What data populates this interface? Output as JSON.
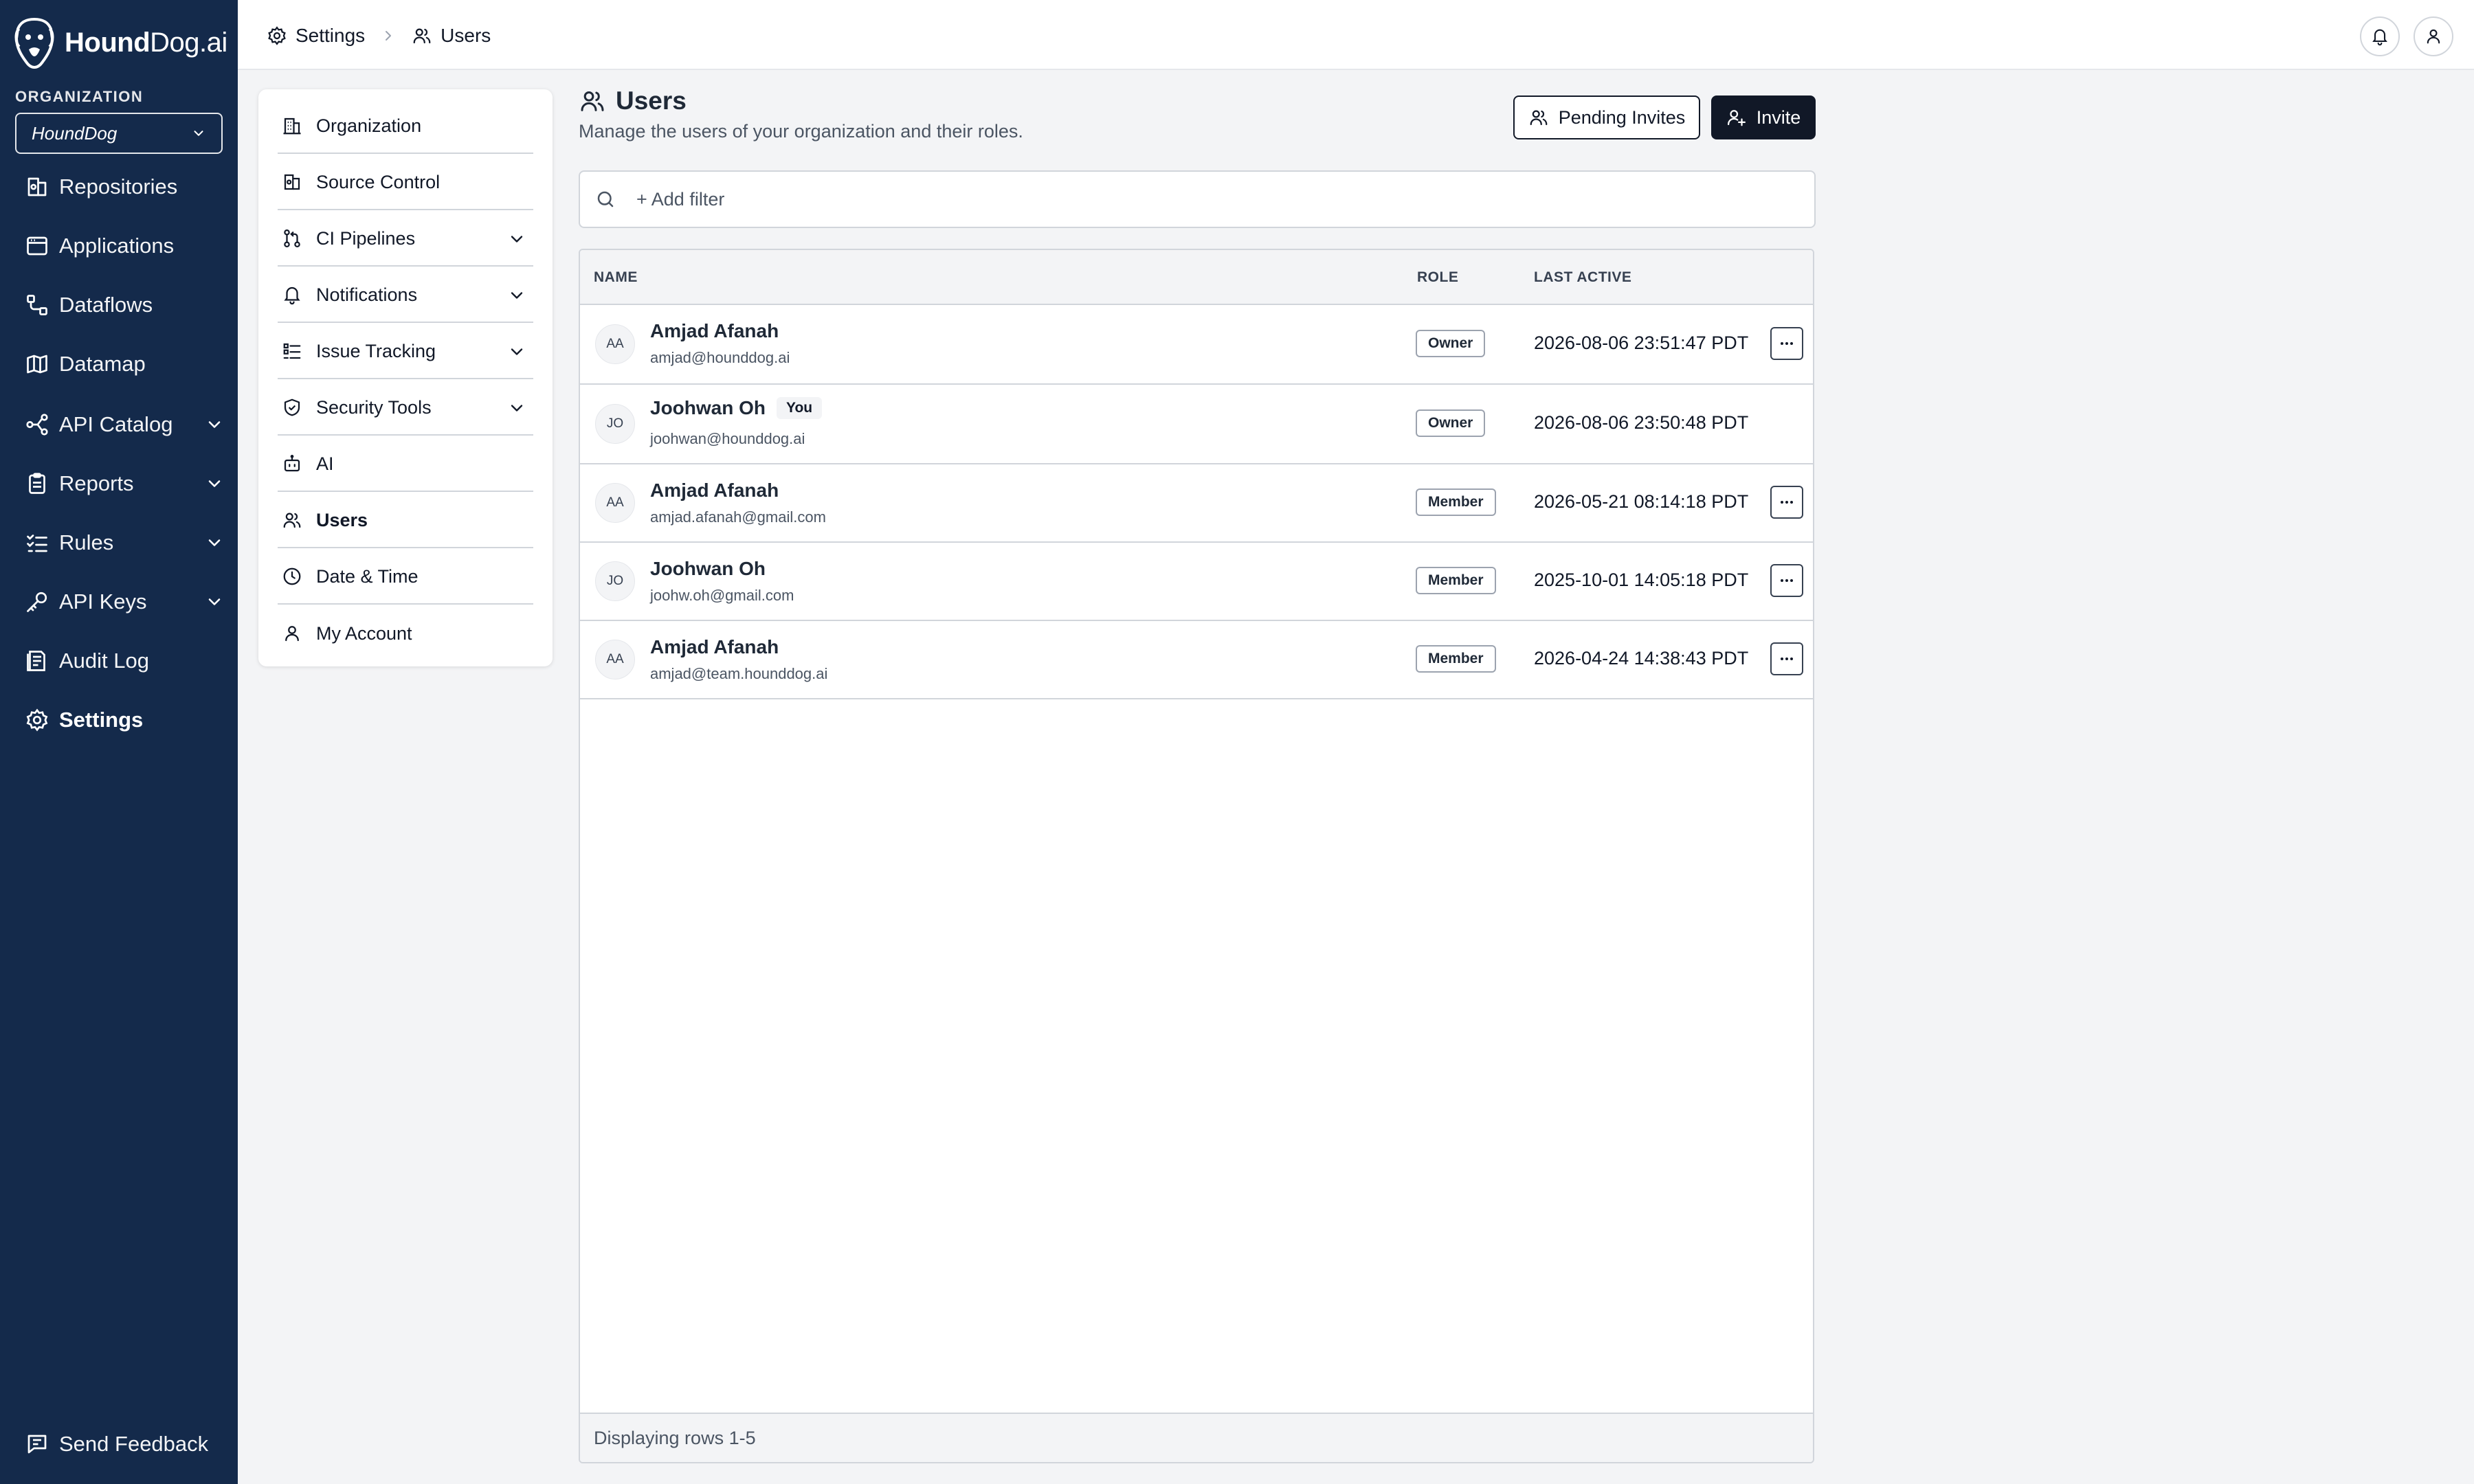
{
  "brand": {
    "name_bold": "Hound",
    "name_rest": "Dog.ai"
  },
  "organization": {
    "label": "ORGANIZATION",
    "selected": "HoundDog"
  },
  "sidebar": {
    "items": [
      {
        "label": "Repositories",
        "icon": "repository-icon"
      },
      {
        "label": "Applications",
        "icon": "application-icon"
      },
      {
        "label": "Dataflows",
        "icon": "dataflow-icon"
      },
      {
        "label": "Datamap",
        "icon": "map-icon"
      },
      {
        "label": "API Catalog",
        "icon": "api-icon",
        "expandable": true
      },
      {
        "label": "Reports",
        "icon": "report-icon",
        "expandable": true
      },
      {
        "label": "Rules",
        "icon": "rules-icon",
        "expandable": true
      },
      {
        "label": "API Keys",
        "icon": "key-icon",
        "expandable": true
      },
      {
        "label": "Audit Log",
        "icon": "audit-log-icon"
      },
      {
        "label": "Settings",
        "icon": "gear-icon",
        "active": true
      }
    ],
    "feedback_label": "Send Feedback"
  },
  "breadcrumb": {
    "root": "Settings",
    "current": "Users"
  },
  "settings_nav": {
    "items": [
      {
        "label": "Organization",
        "icon": "building-icon"
      },
      {
        "label": "Source Control",
        "icon": "source-control-icon"
      },
      {
        "label": "CI Pipelines",
        "icon": "pipeline-icon",
        "expandable": true
      },
      {
        "label": "Notifications",
        "icon": "bell-icon",
        "expandable": true
      },
      {
        "label": "Issue Tracking",
        "icon": "issue-list-icon",
        "expandable": true
      },
      {
        "label": "Security Tools",
        "icon": "shield-icon",
        "expandable": true
      },
      {
        "label": "AI",
        "icon": "bot-icon"
      },
      {
        "label": "Users",
        "icon": "users-icon",
        "active": true
      },
      {
        "label": "Date & Time",
        "icon": "clock-icon"
      },
      {
        "label": "My Account",
        "icon": "user-icon"
      }
    ]
  },
  "page": {
    "title": "Users",
    "subtitle": "Manage the users of your organization and their roles.",
    "pending_invites_label": "Pending Invites",
    "invite_label": "Invite",
    "filter_placeholder": "+ Add filter"
  },
  "table": {
    "columns": {
      "name": "NAME",
      "role": "ROLE",
      "last_active": "LAST ACTIVE"
    },
    "rows": [
      {
        "initials": "AA",
        "name": "Amjad Afanah",
        "email": "amjad@hounddog.ai",
        "role": "Owner",
        "last_active": "2026-08-06 23:51:47 PDT",
        "you": false,
        "actions": true
      },
      {
        "initials": "JO",
        "name": "Joohwan Oh",
        "email": "joohwan@hounddog.ai",
        "role": "Owner",
        "last_active": "2026-08-06 23:50:48 PDT",
        "you": true,
        "you_label": "You",
        "actions": false
      },
      {
        "initials": "AA",
        "name": "Amjad Afanah",
        "email": "amjad.afanah@gmail.com",
        "role": "Member",
        "last_active": "2026-05-21 08:14:18 PDT",
        "you": false,
        "actions": true
      },
      {
        "initials": "JO",
        "name": "Joohwan Oh",
        "email": "joohw.oh@gmail.com",
        "role": "Member",
        "last_active": "2025-10-01 14:05:18 PDT",
        "you": false,
        "actions": true
      },
      {
        "initials": "AA",
        "name": "Amjad Afanah",
        "email": "amjad@team.hounddog.ai",
        "role": "Member",
        "last_active": "2026-04-24 14:38:43 PDT",
        "you": false,
        "actions": true
      }
    ],
    "footer": "Displaying rows 1-5"
  },
  "colors": {
    "sidebar_bg": "#142a4b",
    "primary_button": "#111827",
    "page_bg": "#f3f4f6"
  }
}
